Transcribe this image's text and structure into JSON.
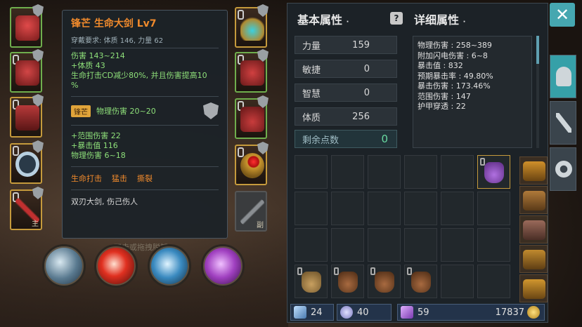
{
  "equipment": {
    "left_slots": [
      {
        "name": "helmet",
        "tag": ""
      },
      {
        "name": "armor",
        "tag": ""
      },
      {
        "name": "pants",
        "tag": ""
      },
      {
        "name": "ring",
        "tag": ""
      },
      {
        "name": "weapon-main",
        "tag": "主"
      }
    ],
    "right_slots": [
      {
        "name": "necklace",
        "tag": ""
      },
      {
        "name": "gloves",
        "tag": ""
      },
      {
        "name": "boots",
        "tag": ""
      },
      {
        "name": "ring-red",
        "tag": ""
      },
      {
        "name": "weapon-offhand",
        "tag": "副"
      }
    ]
  },
  "tooltip": {
    "title": "锋芒 生命大剑 Lv7",
    "requirement": "穿戴要求: 体质 146, 力量 62",
    "base_stats": [
      "伤害  143~214",
      "+体质 43",
      "生命打击CD减少80%, 并且伤害提高10",
      "%"
    ],
    "gem_badge": "锋芒",
    "gem_text": "物理伤害 20~20",
    "extra_stats": [
      "+范围伤害  22",
      "+暴击值 116",
      "物理伤害  6~18"
    ],
    "skills": [
      "生命打击",
      "猛击",
      "撕裂"
    ],
    "description": "双刃大剑, 伤己伤人"
  },
  "hint": "双击或拖拽脱卸",
  "attributes": {
    "header": "基本属性",
    "items": [
      {
        "label": "力量",
        "value": "159"
      },
      {
        "label": "敏捷",
        "value": "0"
      },
      {
        "label": "智慧",
        "value": "0"
      },
      {
        "label": "体质",
        "value": "256"
      }
    ],
    "remaining_label": "剩余点数",
    "remaining_value": "0"
  },
  "detail": {
    "header": "详细属性",
    "rows": [
      "物理伤害 : 258~389",
      "附加闪电伤害 : 6~8",
      "暴击值 : 832",
      "预期暴击率 : 49.80%",
      "暴击伤害 : 173.46%",
      "范围伤害 : 147",
      "护甲穿透 : 22"
    ]
  },
  "footer": {
    "crystal_count": "24",
    "potion_count": "40",
    "gem_count": "59",
    "gold": "17837"
  },
  "icons": {
    "close": "close-icon",
    "help": "question-icon"
  },
  "colors": {
    "accent": "#46a7b0",
    "title_orange": "#f08a2c",
    "stat_green": "#8ee07a"
  }
}
